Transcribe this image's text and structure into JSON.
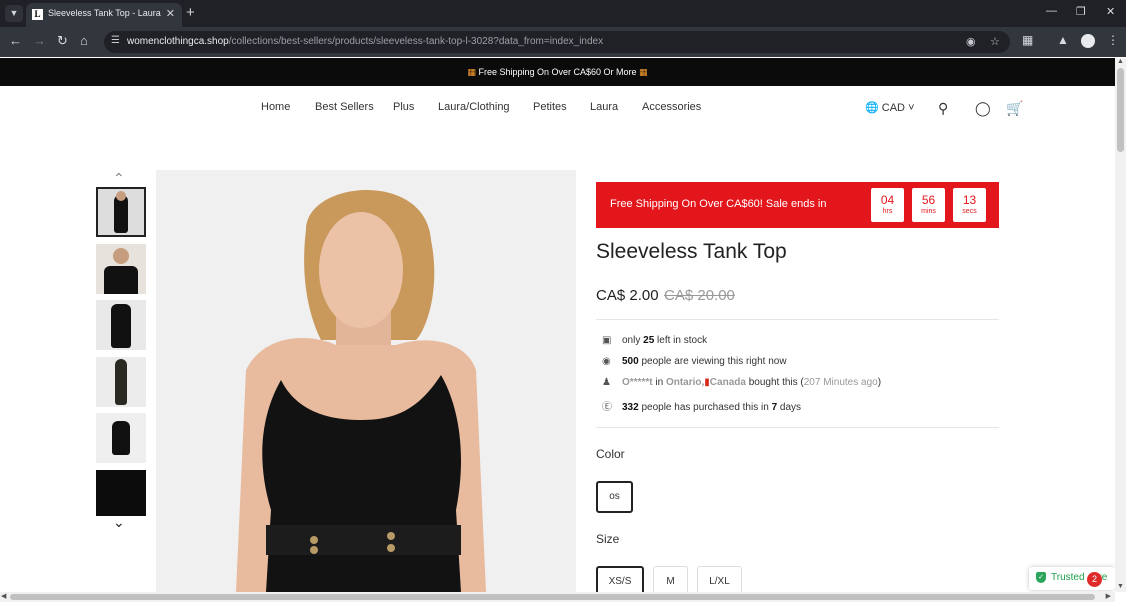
{
  "browser": {
    "tab_title": "Sleeveless Tank Top - Laura",
    "tab_favicon_letter": "L",
    "url_host": "womenclothingca.shop",
    "url_path": "/collections/best-sellers/products/sleeveless-tank-top-l-3028?data_from=index_index"
  },
  "announcement": {
    "text": "Free Shipping On Over CA$60 Or More",
    "icon": "gift-icon"
  },
  "nav": {
    "items": [
      "Home",
      "Best Sellers",
      "Plus",
      "Laura/Clothing",
      "Petites",
      "Laura",
      "Accessories"
    ],
    "currency": "CAD"
  },
  "sale_banner": {
    "text": "Free Shipping On Over CA$60!  Sale ends in",
    "timer": [
      {
        "value": "04",
        "unit": "hrs"
      },
      {
        "value": "56",
        "unit": "mins"
      },
      {
        "value": "13",
        "unit": "secs"
      }
    ],
    "color": "#e3161c"
  },
  "product": {
    "title": "Sleeveless Tank Top",
    "price": "CA$ 2.00",
    "compare_price": "CA$ 20.00"
  },
  "info": {
    "stock_pre": "only",
    "stock_count": "25",
    "stock_post": "left in stock",
    "viewers_count": "500",
    "viewers_post": "people are viewing this right now",
    "buyer_name": "O*****t",
    "buyer_in": "in",
    "buyer_region": "Ontario,",
    "buyer_country": "Canada",
    "buyer_action": "bought this (",
    "buyer_time": "207 Minutes ago",
    "buyer_close": ")",
    "purchased_count": "332",
    "purchased_mid": "people has purchased this in",
    "purchased_days": "7",
    "purchased_post": "days"
  },
  "options": {
    "color_label": "Color",
    "colors": [
      "os"
    ],
    "size_label": "Size",
    "sizes": [
      "XS/S",
      "M",
      "L/XL"
    ]
  },
  "trusted": {
    "label": "Trusted",
    "trailing": "re",
    "badge_count": "2"
  }
}
